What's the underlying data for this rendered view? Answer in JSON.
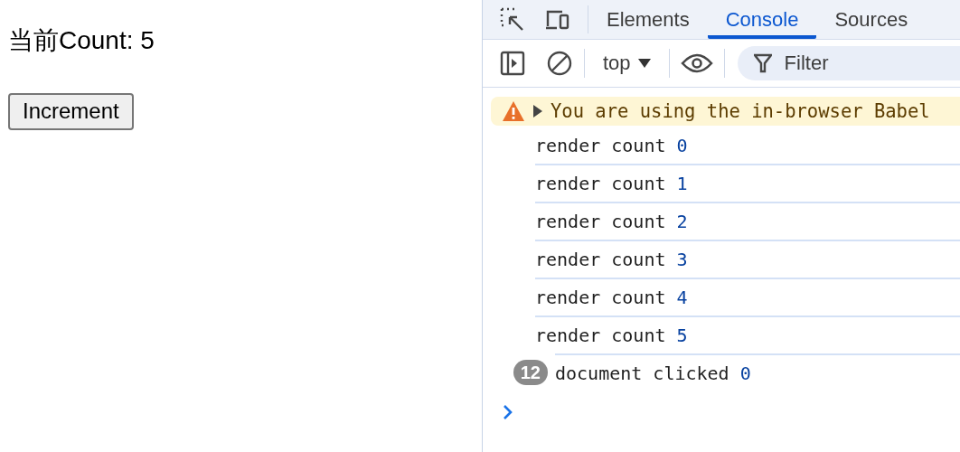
{
  "page": {
    "heading": "当前Count: 5",
    "button": "Increment"
  },
  "devtools": {
    "tabs": [
      {
        "label": "Elements",
        "selected": false
      },
      {
        "label": "Console",
        "selected": true
      },
      {
        "label": "Sources",
        "selected": false
      }
    ],
    "toolbar": {
      "context": "top",
      "filter": {
        "placeholder": "Filter"
      }
    },
    "console": [
      {
        "kind": "warning",
        "text": "You are using the in-browser Babel"
      },
      {
        "kind": "log",
        "message": "render count",
        "value": "0"
      },
      {
        "kind": "log",
        "message": "render count",
        "value": "1"
      },
      {
        "kind": "log",
        "message": "render count",
        "value": "2"
      },
      {
        "kind": "log",
        "message": "render count",
        "value": "3"
      },
      {
        "kind": "log",
        "message": "render count",
        "value": "4"
      },
      {
        "kind": "log",
        "message": "render count",
        "value": "5"
      },
      {
        "kind": "log",
        "message": "document clicked",
        "value": "0",
        "repeat": "12"
      }
    ]
  }
}
